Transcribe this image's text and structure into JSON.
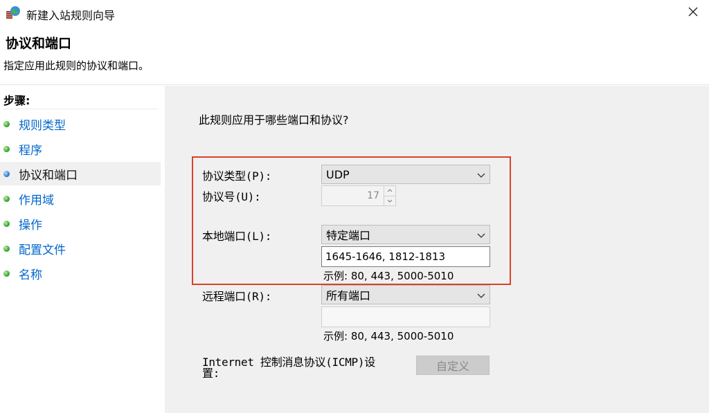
{
  "window": {
    "title": "新建入站规则向导"
  },
  "header": {
    "title": "协议和端口",
    "description": "指定应用此规则的协议和端口。"
  },
  "sidebar": {
    "steps_label": "步骤:",
    "items": [
      {
        "label": "规则类型",
        "state": "done"
      },
      {
        "label": "程序",
        "state": "done"
      },
      {
        "label": "协议和端口",
        "state": "current"
      },
      {
        "label": "作用域",
        "state": "done"
      },
      {
        "label": "操作",
        "state": "done"
      },
      {
        "label": "配置文件",
        "state": "done"
      },
      {
        "label": "名称",
        "state": "done"
      }
    ]
  },
  "main": {
    "question": "此规则应用于哪些端口和协议?",
    "protocol_type": {
      "label": "协议类型(P):",
      "value": "UDP"
    },
    "protocol_number": {
      "label": "协议号(U):",
      "value": "17"
    },
    "local_port": {
      "label": "本地端口(L):",
      "value": "特定端口",
      "input": "1645-1646, 1812-1813",
      "example": "示例: 80, 443, 5000-5010"
    },
    "remote_port": {
      "label": "远程端口(R):",
      "value": "所有端口",
      "input": "",
      "example": "示例: 80, 443, 5000-5010"
    },
    "icmp": {
      "label_line1": "Internet 控制消息协议(ICMP)设",
      "label_line2": "置:",
      "button": "自定义"
    }
  },
  "colors": {
    "link": "#0066cc",
    "highlight": "#d9412a",
    "content_bg": "#f0f0f0"
  }
}
